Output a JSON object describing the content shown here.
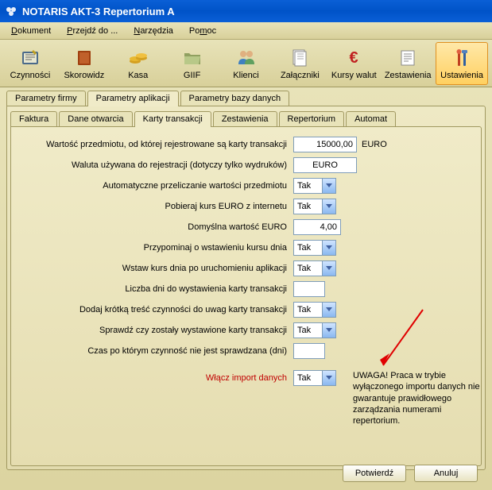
{
  "window": {
    "title": "NOTARIS AKT-3 Repertorium A"
  },
  "menu": {
    "dokument": "Dokument",
    "przejdz": "Przejdź do ...",
    "narzedzia": "Narzędzia",
    "pomoc": "Pomoc"
  },
  "toolbar": {
    "czynnosci": "Czynności",
    "skorowidz": "Skorowidz",
    "kasa": "Kasa",
    "giif": "GIIF",
    "klienci": "Klienci",
    "zalaczniki": "Załączniki",
    "kursy": "Kursy walut",
    "zestawienia": "Zestawienia",
    "ustawienia": "Ustawienia"
  },
  "outerTabs": {
    "firmy": "Parametry firmy",
    "aplikacji": "Parametry aplikacji",
    "bazy": "Parametry bazy danych"
  },
  "innerTabs": {
    "faktura": "Faktura",
    "dane": "Dane otwarcia",
    "karty": "Karty transakcji",
    "zestawienia": "Zestawienia",
    "repertorium": "Repertorium",
    "automat": "Automat"
  },
  "form": {
    "l1": "Wartość przedmiotu, od której rejestrowane są karty transakcji",
    "v1": "15000,00",
    "u1": "EURO",
    "l2": "Waluta używana do rejestracji (dotyczy tylko wydruków)",
    "v2": "EURO",
    "l3": "Automatyczne przeliczanie wartości przedmiotu",
    "v3": "Tak",
    "l4": "Pobieraj kurs EURO z internetu",
    "v4": "Tak",
    "l5": "Domyślna wartość EURO",
    "v5": "4,00",
    "l6": "Przypominaj o wstawieniu kursu dnia",
    "v6": "Tak",
    "l7": "Wstaw kurs dnia po uruchomieniu aplikacji",
    "v7": "Tak",
    "l8": "Liczba dni do wystawienia karty transakcji",
    "v8": "",
    "l9": "Dodaj krótką treść czynności do uwag karty transakcji",
    "v9": "Tak",
    "l10": "Sprawdź czy zostały wystawione karty transakcji",
    "v10": "Tak",
    "l11": "Czas po którym czynność nie jest sprawdzana (dni)",
    "v11": "",
    "l12": "Włącz import danych",
    "v12": "Tak"
  },
  "warning": "UWAGA! Praca w trybie wyłączonego importu danych nie gwarantuje prawidłowego zarządzania numerami repertorium.",
  "buttons": {
    "confirm": "Potwierdź",
    "cancel": "Anuluj"
  }
}
